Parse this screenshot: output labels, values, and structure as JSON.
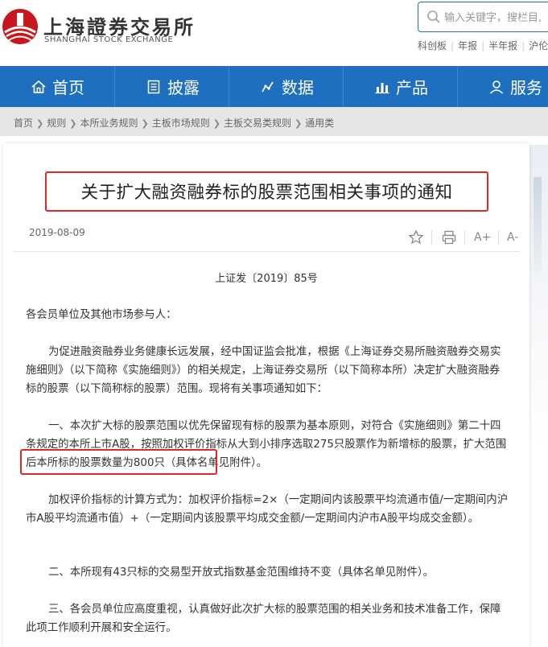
{
  "header": {
    "logo_cn": "上海證券交易所",
    "logo_en": "SHANGHAI STOCK EXCHANGE",
    "search_placeholder": "输入关键字，搜栏目,",
    "quick_links": [
      "科创板",
      "年报",
      "半年报",
      "沪伦"
    ]
  },
  "nav": {
    "items": [
      {
        "label": "首页",
        "icon": "home-icon"
      },
      {
        "label": "披露",
        "icon": "document-icon"
      },
      {
        "label": "数据",
        "icon": "chart-line-icon"
      },
      {
        "label": "产品",
        "icon": "bar-chart-icon"
      },
      {
        "label": "服务",
        "icon": "user-icon"
      }
    ]
  },
  "breadcrumb": [
    "首页",
    "规则",
    "本所业务规则",
    "主板市场规则",
    "主板交易类规则",
    "通用类"
  ],
  "article": {
    "title": "关于扩大融资融券标的股票范围相关事项的通知",
    "date": "2019-08-09",
    "doc_number": "上证发〔2019〕85号",
    "salutation": "各会员单位及其他市场参与人：",
    "para1": "为促进融资融券业务健康长远发展，经中国证监会批准，根据《上海证券交易所融资融券交易实施细则》（以下简称《实施细则》）的相关规定，上海证券交易所（以下简称本所）决定扩大融资融券标的股票（以下简称标的股票）范围。现将有关事项通知如下：",
    "para2_main": "一、本次扩大标的股票范围以优先保留现有标的股票为基本原则，对符合《实施细则》第二十四条规定的本所上市A股，按照加权评价指标从大到小排序选取275只股票作为新增标的股票，",
    "para2_highlight": "扩大范围后本所标的股票数量为800只",
    "para2_tail": "（具体名单见附件）。",
    "para3": "加权评价指标的计算方式为：加权评价指标=2×（一定期间内该股票平均流通市值/一定期间内沪市A股平均流通市值）+（一定期间内该股票平均成交金额/一定期间内沪市A股平均成交金额）。",
    "para4": "二、本所现有43只标的交易型开放式指数基金范围维持不变（具体名单见附件）。",
    "para5": "三、各会员单位应高度重视，认真做好此次扩大标的股票范围的相关业务和技术准备工作，保障此项工作顺利开展和安全运行。"
  },
  "toolbar": {
    "icons": [
      "star-icon",
      "print-icon",
      "font-increase-icon",
      "font-decrease-icon"
    ],
    "font_increase": "A+",
    "font_decrease": "A-"
  },
  "colors": {
    "brand_blue": "#1f6fc0",
    "highlight_red": "#e0282a",
    "logo_red": "#c8161d"
  }
}
